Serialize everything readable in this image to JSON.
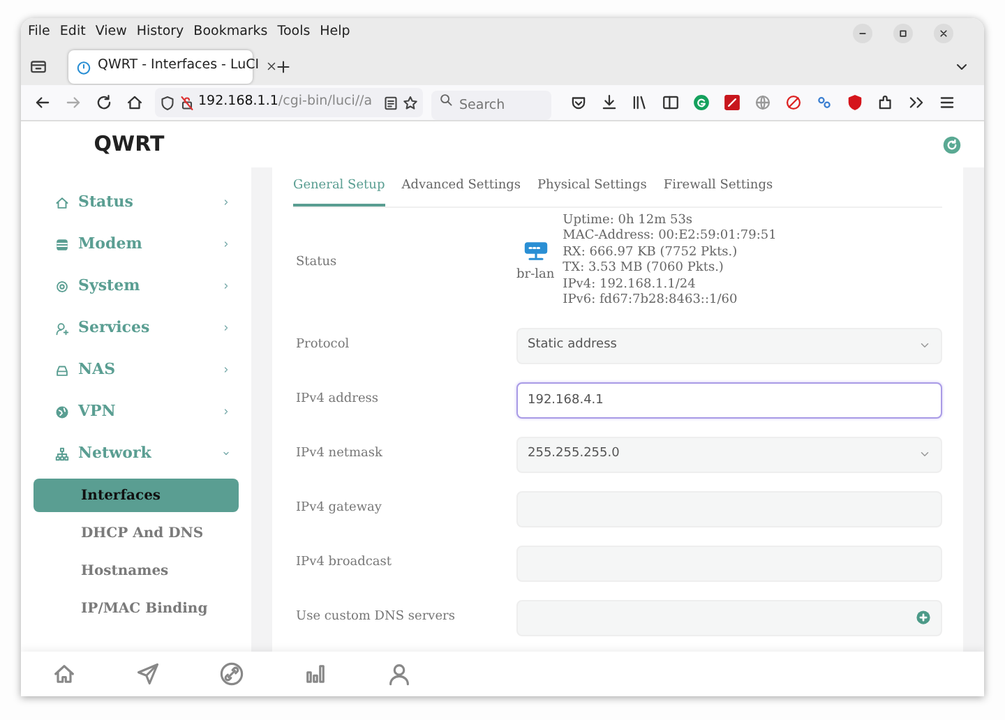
{
  "browser": {
    "menu": [
      "File",
      "Edit",
      "View",
      "History",
      "Bookmarks",
      "Tools",
      "Help"
    ],
    "tab": {
      "title": "QWRT - Interfaces - LuCI"
    },
    "url": {
      "host": "192.168.1.1",
      "path": "/cgi-bin/luci//a"
    },
    "search": {
      "placeholder": "Search"
    }
  },
  "app": {
    "logo": "QWRT",
    "sidebar": {
      "items": [
        {
          "label": "Status",
          "expanded": false
        },
        {
          "label": "Modem",
          "expanded": false
        },
        {
          "label": "System",
          "expanded": false
        },
        {
          "label": "Services",
          "expanded": false
        },
        {
          "label": "NAS",
          "expanded": false
        },
        {
          "label": "VPN",
          "expanded": false
        },
        {
          "label": "Network",
          "expanded": true,
          "children": [
            {
              "label": "Interfaces",
              "selected": true
            },
            {
              "label": "DHCP And DNS",
              "selected": false
            },
            {
              "label": "Hostnames",
              "selected": false
            },
            {
              "label": "IP/MAC Binding",
              "selected": false
            }
          ]
        }
      ]
    },
    "tabs": [
      {
        "label": "General Setup",
        "selected": true
      },
      {
        "label": "Advanced Settings",
        "selected": false
      },
      {
        "label": "Physical Settings",
        "selected": false
      },
      {
        "label": "Firewall Settings",
        "selected": false
      }
    ],
    "status": {
      "label": "Status",
      "device": "br-lan",
      "lines": [
        "Uptime: 0h 12m 53s",
        "MAC-Address: 00:E2:59:01:79:51",
        "RX: 666.97 KB (7752 Pkts.)",
        "TX: 3.53 MB (7060 Pkts.)",
        "IPv4: 192.168.1.1/24",
        "IPv6: fd67:7b28:8463::1/60"
      ]
    },
    "fields": [
      {
        "label": "Protocol",
        "kind": "select",
        "value": "Static address",
        "focused": false
      },
      {
        "label": "IPv4 address",
        "kind": "input",
        "value": "192.168.4.1",
        "focused": true
      },
      {
        "label": "IPv4 netmask",
        "kind": "select",
        "value": "255.255.255.0",
        "focused": false
      },
      {
        "label": "IPv4 gateway",
        "kind": "input",
        "focused": false
      },
      {
        "label": "IPv4 broadcast",
        "kind": "input",
        "focused": false
      },
      {
        "label": "Use custom DNS servers",
        "kind": "list",
        "focused": false
      }
    ]
  }
}
